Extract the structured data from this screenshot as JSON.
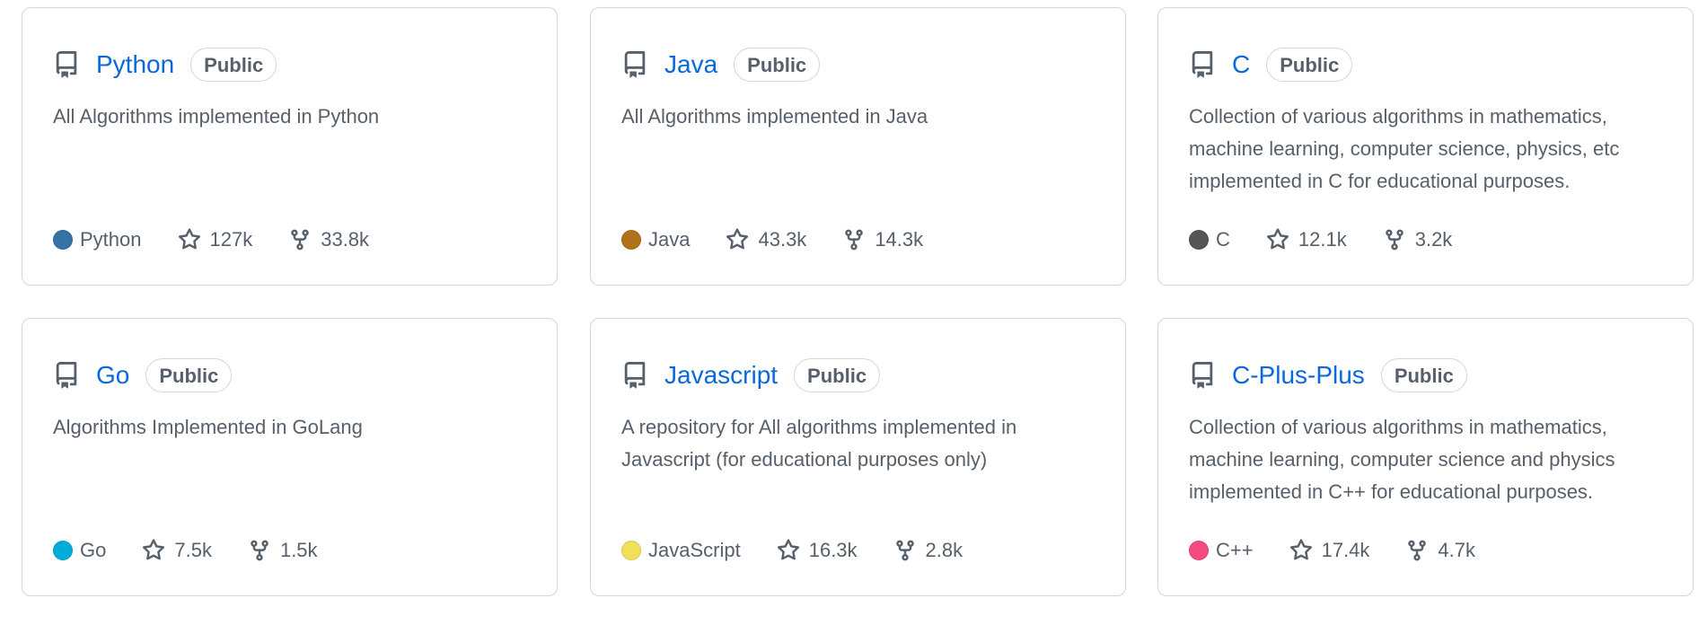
{
  "repos": [
    {
      "name": "Python",
      "visibility": "Public",
      "description": "All Algorithms implemented in Python",
      "language": "Python",
      "language_color": "#3572A5",
      "stars": "127k",
      "forks": "33.8k"
    },
    {
      "name": "Java",
      "visibility": "Public",
      "description": "All Algorithms implemented in Java",
      "language": "Java",
      "language_color": "#b07219",
      "stars": "43.3k",
      "forks": "14.3k"
    },
    {
      "name": "C",
      "visibility": "Public",
      "description": "Collection of various algorithms in mathematics, machine learning, computer science, physics, etc implemented in C for educational purposes.",
      "language": "C",
      "language_color": "#555555",
      "stars": "12.1k",
      "forks": "3.2k"
    },
    {
      "name": "Go",
      "visibility": "Public",
      "description": "Algorithms Implemented in GoLang",
      "language": "Go",
      "language_color": "#00ADD8",
      "stars": "7.5k",
      "forks": "1.5k"
    },
    {
      "name": "Javascript",
      "visibility": "Public",
      "description": "A repository for All algorithms implemented in Javascript (for educational purposes only)",
      "language": "JavaScript",
      "language_color": "#f1e05a",
      "stars": "16.3k",
      "forks": "2.8k"
    },
    {
      "name": "C-Plus-Plus",
      "visibility": "Public",
      "description": "Collection of various algorithms in mathematics, machine learning, computer science and physics implemented in C++ for educational purposes.",
      "language": "C++",
      "language_color": "#f34b7d",
      "stars": "17.4k",
      "forks": "4.7k"
    }
  ],
  "icons": {
    "repo": "repo-icon",
    "star": "star-icon",
    "fork": "fork-icon"
  },
  "colors": {
    "link": "#0969da",
    "muted": "#57606a",
    "border": "#d0d7de"
  }
}
